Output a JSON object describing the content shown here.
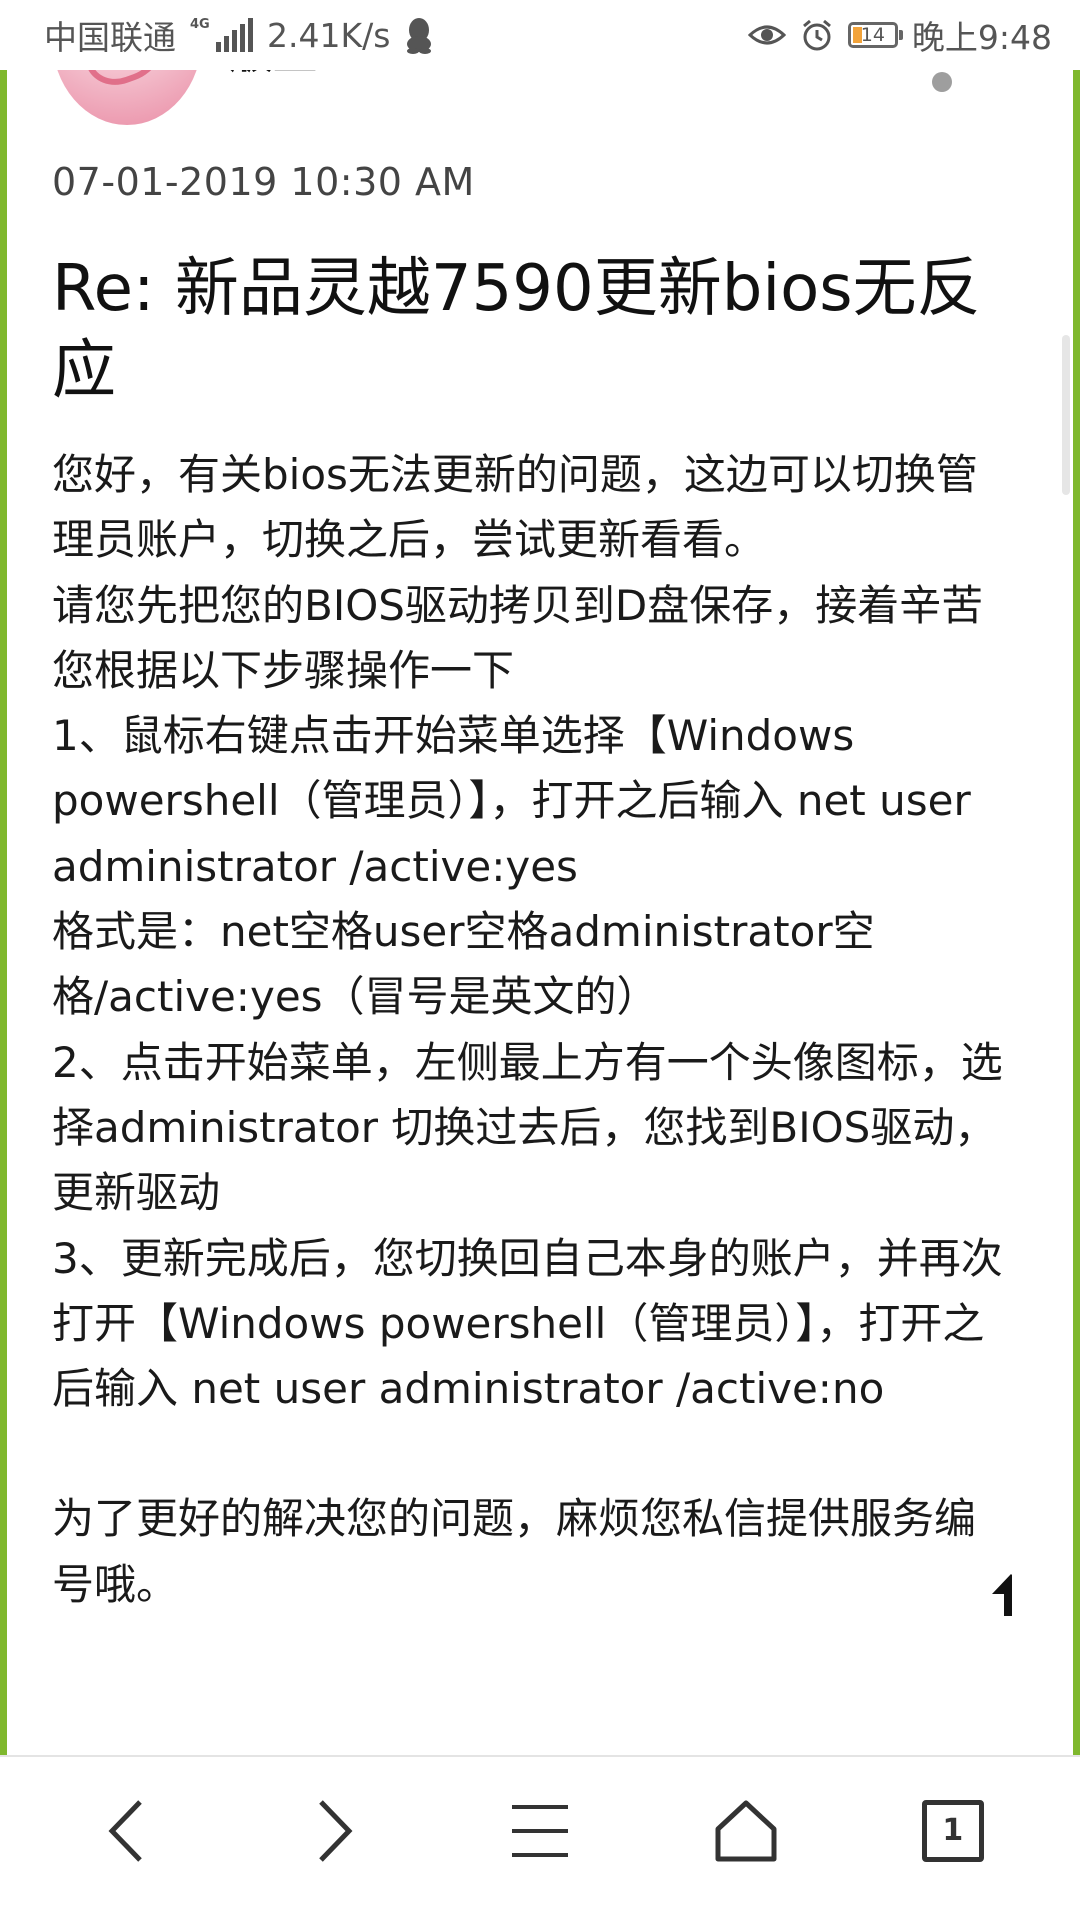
{
  "status_bar": {
    "carrier": "中国联通",
    "network_tag": "4G",
    "speed": "2.41K/s",
    "battery": "14",
    "time": "晚上9:48"
  },
  "post": {
    "username": "版主",
    "timestamp": "07-01-2019 10:30 AM",
    "title": "Re: 新品灵越7590更新bios无反应",
    "body": [
      "您好，有关bios无法更新的问题，这边可以切换管理员账户，切换之后，尝试更新看看。",
      "请您先把您的BIOS驱动拷贝到D盘保存，接着辛苦您根据以下步骤操作一下",
      "1、鼠标右键点击开始菜单选择【Windows powershell（管理员）】，打开之后输入 net user administrator /active:yes",
      "格式是：net空格user空格administrator空格/active:yes（冒号是英文的）",
      "2、点击开始菜单，左侧最上方有一个头像图标，选择administrator 切换过去后，您找到BIOS驱动，更新驱动",
      "3、更新完成后，您切换回自己本身的账户，并再次打开【Windows powershell（管理员）】，打开之后输入 net user administrator /active:no",
      "",
      "为了更好的解决您的问题，麻烦您私信提供服务编号哦。"
    ]
  },
  "bottom_nav": {
    "tabs_count": "1"
  },
  "icons": {
    "back": "chevron-left-icon",
    "forward": "chevron-right-icon",
    "menu": "hamburger-menu-icon",
    "home": "home-icon",
    "tabs": "tabs-icon",
    "back_to_top": "arrow-up-icon"
  },
  "colors": {
    "accent_green": "#7fb82e",
    "battery_fill": "#f2a33a"
  }
}
